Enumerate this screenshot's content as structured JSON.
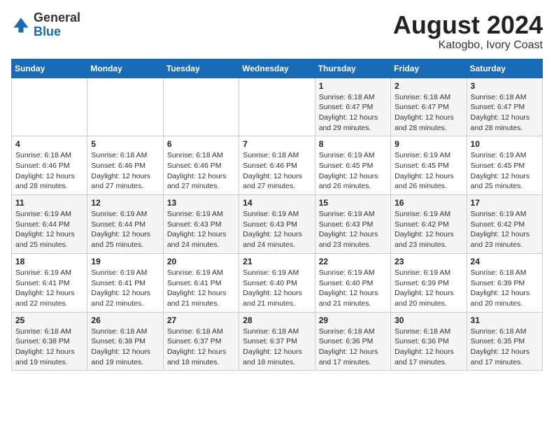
{
  "header": {
    "logo_line1": "General",
    "logo_line2": "Blue",
    "month_year": "August 2024",
    "location": "Katogbo, Ivory Coast"
  },
  "weekdays": [
    "Sunday",
    "Monday",
    "Tuesday",
    "Wednesday",
    "Thursday",
    "Friday",
    "Saturday"
  ],
  "weeks": [
    [
      {
        "day": "",
        "info": ""
      },
      {
        "day": "",
        "info": ""
      },
      {
        "day": "",
        "info": ""
      },
      {
        "day": "",
        "info": ""
      },
      {
        "day": "1",
        "info": "Sunrise: 6:18 AM\nSunset: 6:47 PM\nDaylight: 12 hours\nand 29 minutes."
      },
      {
        "day": "2",
        "info": "Sunrise: 6:18 AM\nSunset: 6:47 PM\nDaylight: 12 hours\nand 28 minutes."
      },
      {
        "day": "3",
        "info": "Sunrise: 6:18 AM\nSunset: 6:47 PM\nDaylight: 12 hours\nand 28 minutes."
      }
    ],
    [
      {
        "day": "4",
        "info": "Sunrise: 6:18 AM\nSunset: 6:46 PM\nDaylight: 12 hours\nand 28 minutes."
      },
      {
        "day": "5",
        "info": "Sunrise: 6:18 AM\nSunset: 6:46 PM\nDaylight: 12 hours\nand 27 minutes."
      },
      {
        "day": "6",
        "info": "Sunrise: 6:18 AM\nSunset: 6:46 PM\nDaylight: 12 hours\nand 27 minutes."
      },
      {
        "day": "7",
        "info": "Sunrise: 6:18 AM\nSunset: 6:46 PM\nDaylight: 12 hours\nand 27 minutes."
      },
      {
        "day": "8",
        "info": "Sunrise: 6:19 AM\nSunset: 6:45 PM\nDaylight: 12 hours\nand 26 minutes."
      },
      {
        "day": "9",
        "info": "Sunrise: 6:19 AM\nSunset: 6:45 PM\nDaylight: 12 hours\nand 26 minutes."
      },
      {
        "day": "10",
        "info": "Sunrise: 6:19 AM\nSunset: 6:45 PM\nDaylight: 12 hours\nand 25 minutes."
      }
    ],
    [
      {
        "day": "11",
        "info": "Sunrise: 6:19 AM\nSunset: 6:44 PM\nDaylight: 12 hours\nand 25 minutes."
      },
      {
        "day": "12",
        "info": "Sunrise: 6:19 AM\nSunset: 6:44 PM\nDaylight: 12 hours\nand 25 minutes."
      },
      {
        "day": "13",
        "info": "Sunrise: 6:19 AM\nSunset: 6:43 PM\nDaylight: 12 hours\nand 24 minutes."
      },
      {
        "day": "14",
        "info": "Sunrise: 6:19 AM\nSunset: 6:43 PM\nDaylight: 12 hours\nand 24 minutes."
      },
      {
        "day": "15",
        "info": "Sunrise: 6:19 AM\nSunset: 6:43 PM\nDaylight: 12 hours\nand 23 minutes."
      },
      {
        "day": "16",
        "info": "Sunrise: 6:19 AM\nSunset: 6:42 PM\nDaylight: 12 hours\nand 23 minutes."
      },
      {
        "day": "17",
        "info": "Sunrise: 6:19 AM\nSunset: 6:42 PM\nDaylight: 12 hours\nand 23 minutes."
      }
    ],
    [
      {
        "day": "18",
        "info": "Sunrise: 6:19 AM\nSunset: 6:41 PM\nDaylight: 12 hours\nand 22 minutes."
      },
      {
        "day": "19",
        "info": "Sunrise: 6:19 AM\nSunset: 6:41 PM\nDaylight: 12 hours\nand 22 minutes."
      },
      {
        "day": "20",
        "info": "Sunrise: 6:19 AM\nSunset: 6:41 PM\nDaylight: 12 hours\nand 21 minutes."
      },
      {
        "day": "21",
        "info": "Sunrise: 6:19 AM\nSunset: 6:40 PM\nDaylight: 12 hours\nand 21 minutes."
      },
      {
        "day": "22",
        "info": "Sunrise: 6:19 AM\nSunset: 6:40 PM\nDaylight: 12 hours\nand 21 minutes."
      },
      {
        "day": "23",
        "info": "Sunrise: 6:19 AM\nSunset: 6:39 PM\nDaylight: 12 hours\nand 20 minutes."
      },
      {
        "day": "24",
        "info": "Sunrise: 6:18 AM\nSunset: 6:39 PM\nDaylight: 12 hours\nand 20 minutes."
      }
    ],
    [
      {
        "day": "25",
        "info": "Sunrise: 6:18 AM\nSunset: 6:38 PM\nDaylight: 12 hours\nand 19 minutes."
      },
      {
        "day": "26",
        "info": "Sunrise: 6:18 AM\nSunset: 6:38 PM\nDaylight: 12 hours\nand 19 minutes."
      },
      {
        "day": "27",
        "info": "Sunrise: 6:18 AM\nSunset: 6:37 PM\nDaylight: 12 hours\nand 18 minutes."
      },
      {
        "day": "28",
        "info": "Sunrise: 6:18 AM\nSunset: 6:37 PM\nDaylight: 12 hours\nand 18 minutes."
      },
      {
        "day": "29",
        "info": "Sunrise: 6:18 AM\nSunset: 6:36 PM\nDaylight: 12 hours\nand 17 minutes."
      },
      {
        "day": "30",
        "info": "Sunrise: 6:18 AM\nSunset: 6:36 PM\nDaylight: 12 hours\nand 17 minutes."
      },
      {
        "day": "31",
        "info": "Sunrise: 6:18 AM\nSunset: 6:35 PM\nDaylight: 12 hours\nand 17 minutes."
      }
    ]
  ]
}
